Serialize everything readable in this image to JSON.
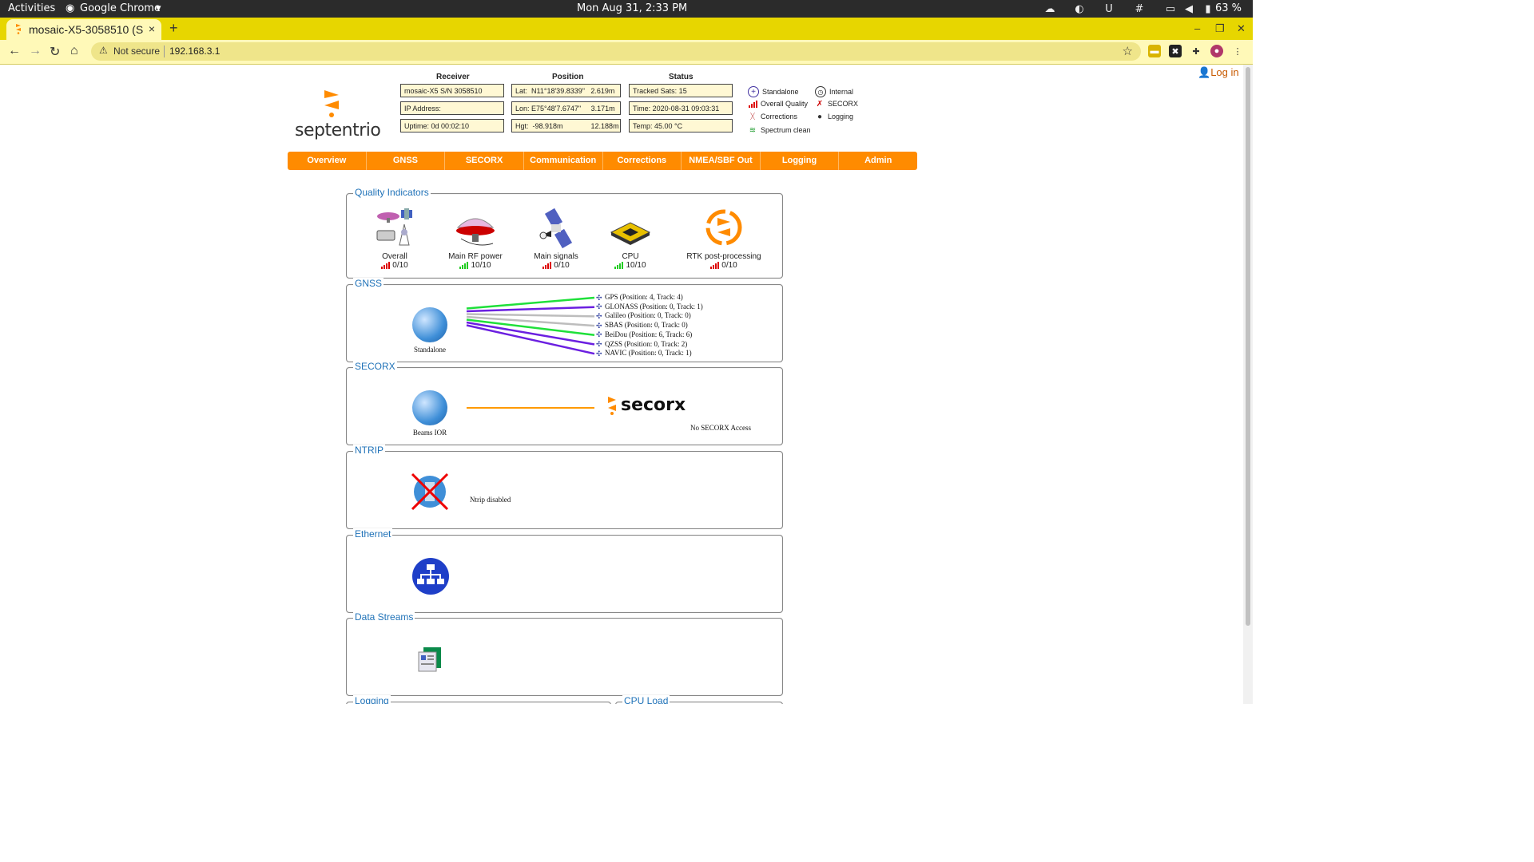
{
  "os": {
    "activities": "Activities",
    "app": "Google Chrome",
    "clock": "Mon Aug 31,  2:33 PM",
    "battery": "63 %"
  },
  "browser": {
    "tab_title": "mosaic-X5-3058510 (S",
    "tab_close": "×",
    "new_tab": "+",
    "not_secure": "Not secure",
    "url": "192.168.3.1"
  },
  "page": {
    "login": "Log in",
    "logo_text": "septentrio",
    "header": {
      "receiver_title": "Receiver",
      "position_title": "Position",
      "status_title": "Status",
      "receiver": [
        "mosaic-X5 S/N 3058510",
        "IP Address:",
        "Uptime: 0d 00:02:10"
      ],
      "position": [
        "Lat:  N11°18'39.8339\"   2.619m",
        "Lon: E75°48'7.6747\"     3.171m",
        "Hgt:  -98.918m              12.188m"
      ],
      "status": [
        "Tracked Sats: 15",
        "Time: 2020-08-31 09:03:31",
        "Temp: 45.00 °C"
      ]
    },
    "legend": {
      "standalone": "Standalone",
      "overall_quality": "Overall Quality",
      "corrections": "Corrections",
      "spectrum_clean": "Spectrum clean",
      "internal": "Internal",
      "secorx": "SECORX",
      "logging": "Logging"
    },
    "menu": [
      "Overview",
      "GNSS",
      "SECORX",
      "Communication",
      "Corrections",
      "NMEA/SBF Out",
      "Logging",
      "Admin"
    ],
    "panels": {
      "quality": {
        "title": "Quality Indicators",
        "items": [
          {
            "label": "Overall",
            "value": "0/10",
            "level": 0
          },
          {
            "label": "Main RF power",
            "value": "10/10",
            "level": 10
          },
          {
            "label": "Main signals",
            "value": "0/10",
            "level": 0
          },
          {
            "label": "CPU",
            "value": "10/10",
            "level": 10
          },
          {
            "label": "RTK post-processing",
            "value": "0/10",
            "level": 0
          }
        ]
      },
      "gnss": {
        "title": "GNSS",
        "mode": "Standalone",
        "constellations": [
          {
            "text": "GPS (Position: 4, Track: 4)",
            "color": "#1fe03a"
          },
          {
            "text": "GLONASS (Position: 0, Track: 1)",
            "color": "#6b1fe0"
          },
          {
            "text": "Galileo (Position: 0, Track: 0)",
            "color": "#bdbdbd"
          },
          {
            "text": "SBAS (Position: 0, Track: 0)",
            "color": "#bdbdbd"
          },
          {
            "text": "BeiDou (Position: 6, Track: 6)",
            "color": "#1fe03a"
          },
          {
            "text": "QZSS (Position: 0, Track: 2)",
            "color": "#6b1fe0"
          },
          {
            "text": "NAVIC (Position: 0, Track: 1)",
            "color": "#6b1fe0"
          }
        ]
      },
      "secorx": {
        "title": "SECORX",
        "beam": "Beams IOR",
        "brand": "secorx",
        "status": "No SECORX Access"
      },
      "ntrip": {
        "title": "NTRIP",
        "status": "Ntrip disabled"
      },
      "ethernet": {
        "title": "Ethernet"
      },
      "datastreams": {
        "title": "Data Streams"
      },
      "logging": {
        "title": "Logging"
      },
      "cpuload": {
        "title": "CPU Load"
      }
    }
  }
}
